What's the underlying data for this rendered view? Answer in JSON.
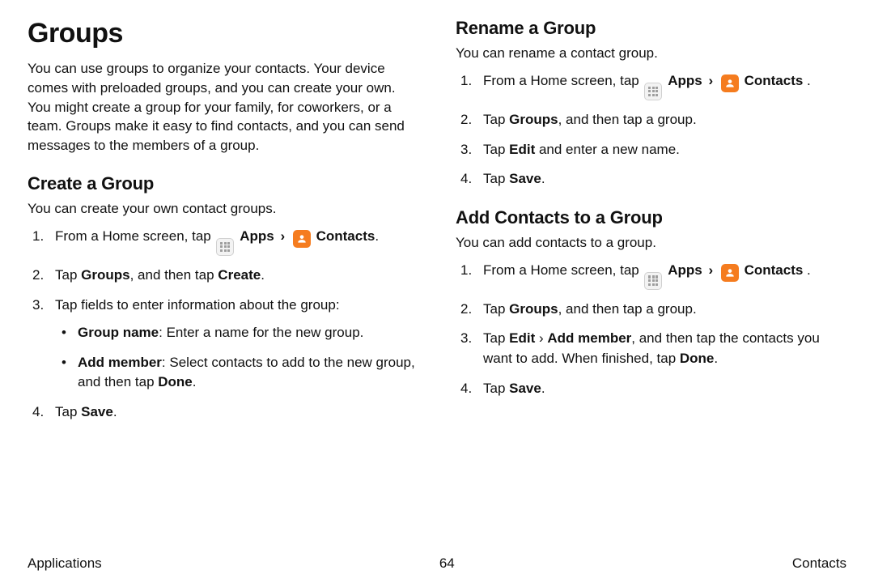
{
  "title": "Groups",
  "intro": "You can use groups to organize your contacts. Your device comes with preloaded groups, and you can create your own. You might create a group for your family, for coworkers, or a team. Groups make it easy to find contacts, and you can send messages to the members of a group.",
  "labels": {
    "apps": "Apps",
    "contacts": "Contacts"
  },
  "arrow": "›",
  "create": {
    "heading": "Create a Group",
    "intro": "You can create your own contact groups.",
    "step1_prefix": "From a Home screen, tap ",
    "step1_suffix": ".",
    "step2": {
      "pre": "Tap ",
      "b1": "Groups",
      "mid": ", and then tap ",
      "b2": "Create",
      "post": "."
    },
    "step3": "Tap fields to enter information about the group:",
    "b1_label": "Group name",
    "b1_text": ": Enter a name for the new group.",
    "b2_label": "Add member",
    "b2_text_pre": ": Select contacts to add to the new group, and then tap ",
    "b2_done": "Done",
    "b2_text_post": ".",
    "step4": {
      "pre": "Tap ",
      "b": "Save",
      "post": "."
    }
  },
  "rename": {
    "heading": "Rename a Group",
    "intro": "You can rename a contact group.",
    "step1_prefix": "From a Home screen, tap ",
    "step1_suffix": " .",
    "step2": {
      "pre": "Tap ",
      "b1": "Groups",
      "post": ", and then tap a group."
    },
    "step3": {
      "pre": "Tap ",
      "b1": "Edit",
      "post": " and enter a new name."
    },
    "step4": {
      "pre": "Tap ",
      "b": "Save",
      "post": "."
    }
  },
  "add": {
    "heading": "Add Contacts to a Group",
    "intro": "You can add contacts to a group.",
    "step1_prefix": "From a Home screen, tap ",
    "step1_suffix": " .",
    "step2": {
      "pre": "Tap ",
      "b1": "Groups",
      "post": ", and then tap a group."
    },
    "step3": {
      "pre": "Tap ",
      "b1": "Edit",
      "arrow": " › ",
      "b2": "Add member",
      "mid": ", and then tap the contacts you want to add. When finished, tap ",
      "b3": "Done",
      "post": "."
    },
    "step4": {
      "pre": "Tap ",
      "b": "Save",
      "post": "."
    }
  },
  "footer": {
    "left": "Applications",
    "page": "64",
    "right": "Contacts"
  }
}
